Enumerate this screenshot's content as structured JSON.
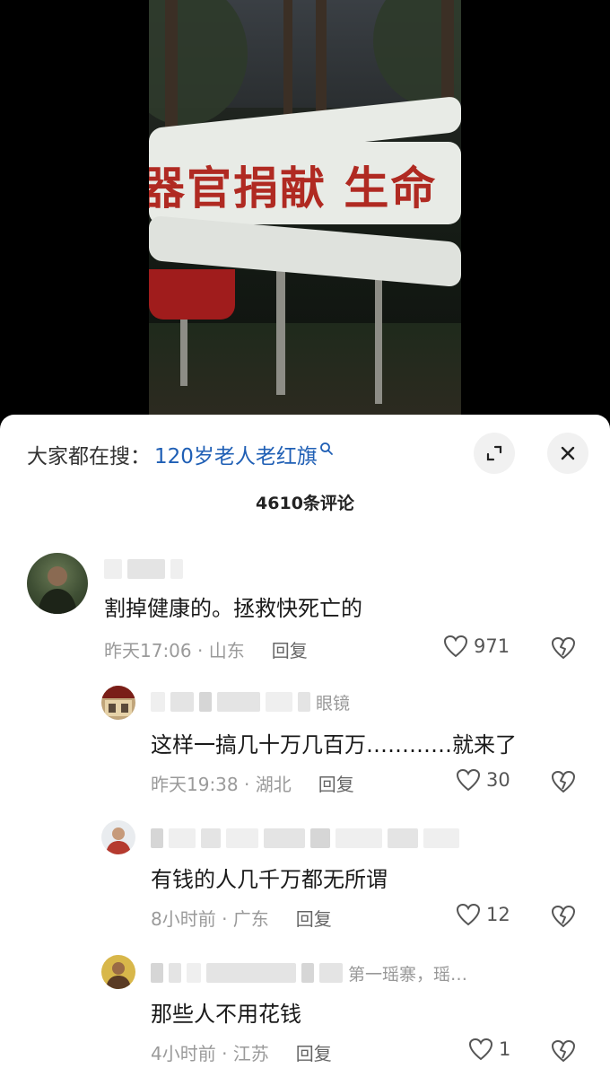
{
  "video": {
    "sign_text": "器官捐献 生命"
  },
  "sheet": {
    "search_label": "大家都在搜：",
    "search_term": "120岁老人老红旗",
    "comment_count": "4610条评论"
  },
  "comments": [
    {
      "content": "割掉健康的。拯救快死亡的",
      "time_location": "昨天17:06 · 山东",
      "reply_label": "回复",
      "likes": "971"
    },
    {
      "name_visible": "眼镜",
      "content": "这样一搞几十万几百万…………就来了",
      "time_location": "昨天19:38 · 湖北",
      "reply_label": "回复",
      "likes": "30"
    },
    {
      "content": "有钱的人几千万都无所谓",
      "time_location": "8小时前 · 广东",
      "reply_label": "回复",
      "likes": "12"
    },
    {
      "name_visible": "第一瑶寨，瑶…",
      "content": "那些人不用花钱",
      "time_location": "4小时前 · 江苏",
      "reply_label": "回复",
      "likes": "1"
    }
  ],
  "icons": {
    "search": "search-icon",
    "expand": "expand-icon",
    "close": "close-icon",
    "like": "heart-outline-icon",
    "dislike": "broken-heart-icon"
  },
  "colors": {
    "search_term": "#1f5fb5",
    "sheet_bg": "#ffffff"
  }
}
